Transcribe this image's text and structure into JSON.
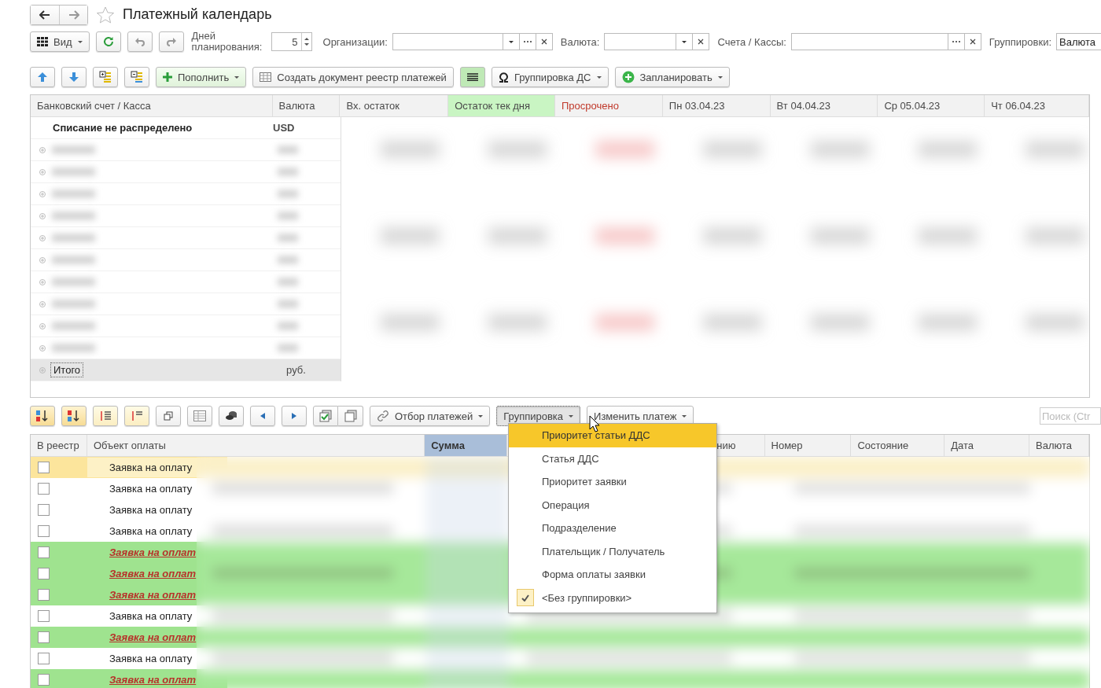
{
  "window": {
    "title": "Платежный календарь",
    "favorite": false
  },
  "filters": {
    "view_button": "Вид",
    "days_label": "Дней планирования:",
    "days_value": "5",
    "org_label": "Организации:",
    "currency_label": "Валюта:",
    "accounts_label": "Счета / Кассы:",
    "groupings_label": "Группировки:",
    "groupings_value": "Валюта"
  },
  "toolbar": {
    "replenish_button": "Пополнить",
    "create_register_button": "Создать документ реестр платежей",
    "list_mode_on": true,
    "cash_grouping_button": "Группировка ДС",
    "plan_button": "Запланировать"
  },
  "balance_table": {
    "columns": [
      {
        "label": "Банковский счет / Касса",
        "kind": "account"
      },
      {
        "label": "Валюта",
        "kind": "currency"
      },
      {
        "label": "Вх. остаток",
        "kind": "day"
      },
      {
        "label": "Остаток тек дня",
        "kind": "current"
      },
      {
        "label": "Просрочено",
        "kind": "overdue"
      },
      {
        "label": "Пн 03.04.23",
        "kind": "day"
      },
      {
        "label": "Вт 04.04.23",
        "kind": "day"
      },
      {
        "label": "Ср 05.04.23",
        "kind": "day"
      },
      {
        "label": "Чт 06.04.23",
        "kind": "day"
      }
    ],
    "rows": [
      {
        "kind": "group",
        "account": "Списание не распределено",
        "currency": "USD"
      },
      {
        "kind": "blurred"
      },
      {
        "kind": "blurred"
      },
      {
        "kind": "blurred"
      },
      {
        "kind": "blurred"
      },
      {
        "kind": "blurred"
      },
      {
        "kind": "blurred"
      },
      {
        "kind": "blurred"
      },
      {
        "kind": "blurred"
      },
      {
        "kind": "blurred"
      },
      {
        "kind": "blurred"
      },
      {
        "kind": "total",
        "account": "Итого",
        "currency": "руб."
      }
    ]
  },
  "payments_toolbar": {
    "filter_button": "Отбор платежей",
    "grouping_button": {
      "label": "Группировка",
      "pressed": true
    },
    "change_button": "Изменить платеж",
    "search": {
      "placeholder": "Поиск (Ctr"
    }
  },
  "payments_table": {
    "columns": [
      {
        "label": "В реестр",
        "kind": "normal"
      },
      {
        "label": "Объект оплаты",
        "kind": "normal"
      },
      {
        "label": "Сумма",
        "kind": "sorted"
      },
      {
        "label": "нию",
        "kind": "covered"
      },
      {
        "label": "Номер",
        "kind": "normal"
      },
      {
        "label": "Состояние",
        "kind": "normal"
      },
      {
        "label": "Дата",
        "kind": "normal"
      },
      {
        "label": "Валюта",
        "kind": "normal"
      }
    ],
    "rows": [
      {
        "checked": false,
        "selected": true,
        "kind": "normal",
        "object": "Заявка на оплату"
      },
      {
        "checked": false,
        "selected": false,
        "kind": "normal",
        "object": "Заявка на оплату"
      },
      {
        "checked": false,
        "selected": false,
        "kind": "normal",
        "object": "Заявка на оплату"
      },
      {
        "checked": false,
        "selected": false,
        "kind": "normal",
        "object": "Заявка на оплату"
      },
      {
        "checked": false,
        "selected": false,
        "kind": "urgent",
        "object": "Заявка на оплат"
      },
      {
        "checked": false,
        "selected": false,
        "kind": "urgent",
        "object": "Заявка на оплат"
      },
      {
        "checked": false,
        "selected": false,
        "kind": "urgent",
        "object": "Заявка на оплат"
      },
      {
        "checked": false,
        "selected": false,
        "kind": "normal",
        "object": "Заявка на оплату"
      },
      {
        "checked": false,
        "selected": false,
        "kind": "urgent",
        "object": "Заявка на оплат"
      },
      {
        "checked": false,
        "selected": false,
        "kind": "normal",
        "object": "Заявка на оплату"
      },
      {
        "checked": false,
        "selected": false,
        "kind": "urgent",
        "object": "Заявка на оплат"
      }
    ]
  },
  "grouping_menu": {
    "items": [
      {
        "label": "Приоритет статьи ДДС",
        "selected": true,
        "checked": false
      },
      {
        "label": "Статья ДДС",
        "selected": false,
        "checked": false
      },
      {
        "label": "Приоритет заявки",
        "selected": false,
        "checked": false
      },
      {
        "label": "Операция",
        "selected": false,
        "checked": false
      },
      {
        "label": "Подразделение",
        "selected": false,
        "checked": false
      },
      {
        "label": "Плательщик / Получатель",
        "selected": false,
        "checked": false
      },
      {
        "label": "Форма оплаты заявки",
        "selected": false,
        "checked": false
      },
      {
        "label": "<Без группировки>",
        "selected": false,
        "checked": true
      }
    ]
  }
}
